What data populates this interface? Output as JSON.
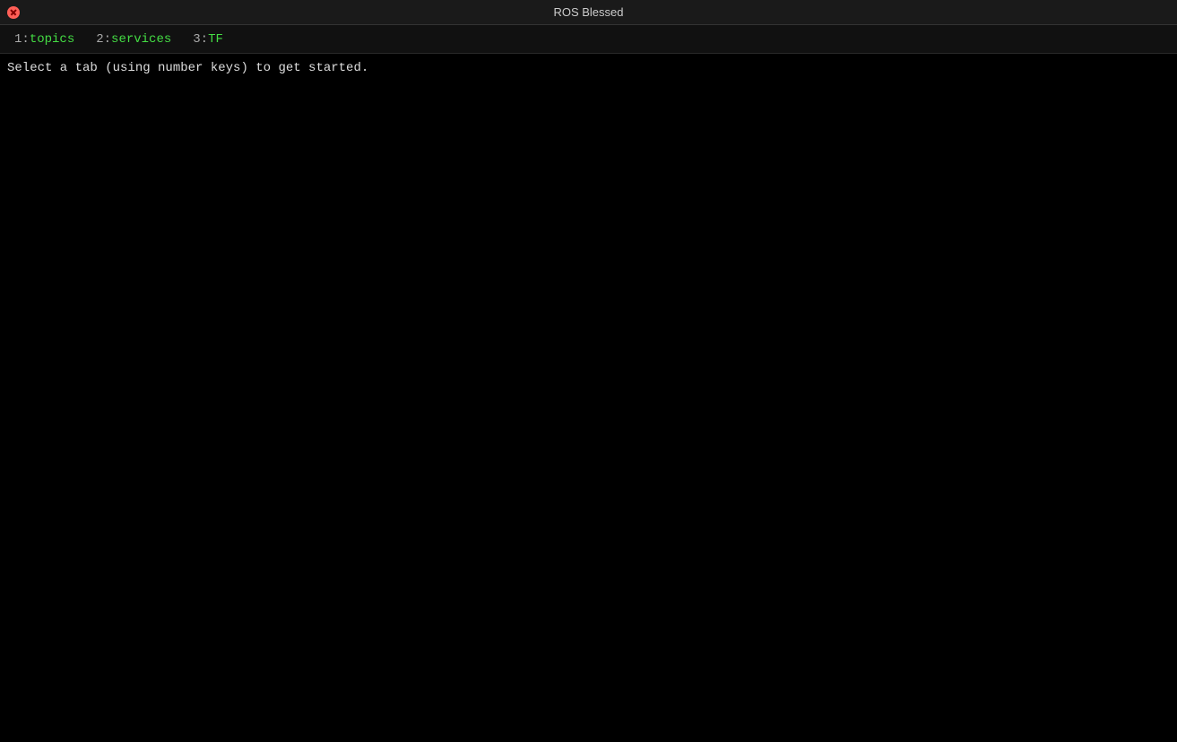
{
  "window": {
    "title": "ROS Blessed"
  },
  "tabs": [
    {
      "number": "1",
      "separator": ":",
      "name": "topics"
    },
    {
      "number": "2",
      "separator": ":",
      "name": "services"
    },
    {
      "number": "3",
      "separator": ":",
      "name": "TF"
    }
  ],
  "content": {
    "status_message": "Select a tab (using number keys) to get started."
  },
  "colors": {
    "tab_number": "#aaaaaa",
    "tab_name": "#44dd44",
    "close_button": "#ff5f57",
    "background": "#000000",
    "title_bar_bg": "#1a1a1a",
    "tab_bar_bg": "#111111"
  }
}
